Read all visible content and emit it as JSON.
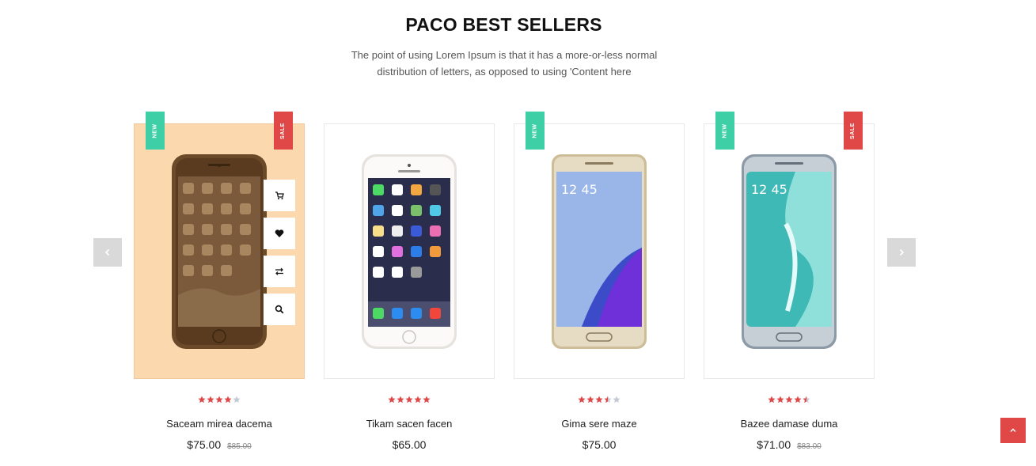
{
  "section": {
    "title": "PACO BEST SELLERS",
    "description_line1": "The point of using Lorem Ipsum is that it has a more-or-less normal",
    "description_line2": "distribution of letters, as opposed to using 'Content here"
  },
  "colors": {
    "new_badge": "#3ecfa6",
    "sale_badge": "#e04747",
    "star_on": "#e04747",
    "star_off": "#c4c9d4",
    "hover_bg": "#fbd8ad"
  },
  "icons": {
    "prev": "chevron-left-icon",
    "next": "chevron-right-icon",
    "cart": "cart-icon",
    "wishlist": "heart-icon",
    "compare": "compare-arrows-icon",
    "quickview": "search-icon",
    "scroll_top": "chevron-up-icon"
  },
  "products": [
    {
      "name": "Saceam mirea dacema",
      "price": "$75.00",
      "old_price": "$85.00",
      "rating": 4,
      "badge_new": "NEW",
      "badge_sale": "SALE",
      "phone": "iphone-gold"
    },
    {
      "name": "Tikam sacen facen",
      "price": "$65.00",
      "old_price": "",
      "rating": 5,
      "badge_new": "",
      "badge_sale": "",
      "phone": "iphone-white"
    },
    {
      "name": "Gima sere maze",
      "price": "$75.00",
      "old_price": "",
      "rating": 3.5,
      "badge_new": "NEW",
      "badge_sale": "",
      "phone": "galaxy-note"
    },
    {
      "name": "Bazee damase duma",
      "price": "$71.00",
      "old_price": "$83.00",
      "rating": 4.5,
      "badge_new": "NEW",
      "badge_sale": "SALE",
      "phone": "galaxy-edge"
    }
  ]
}
